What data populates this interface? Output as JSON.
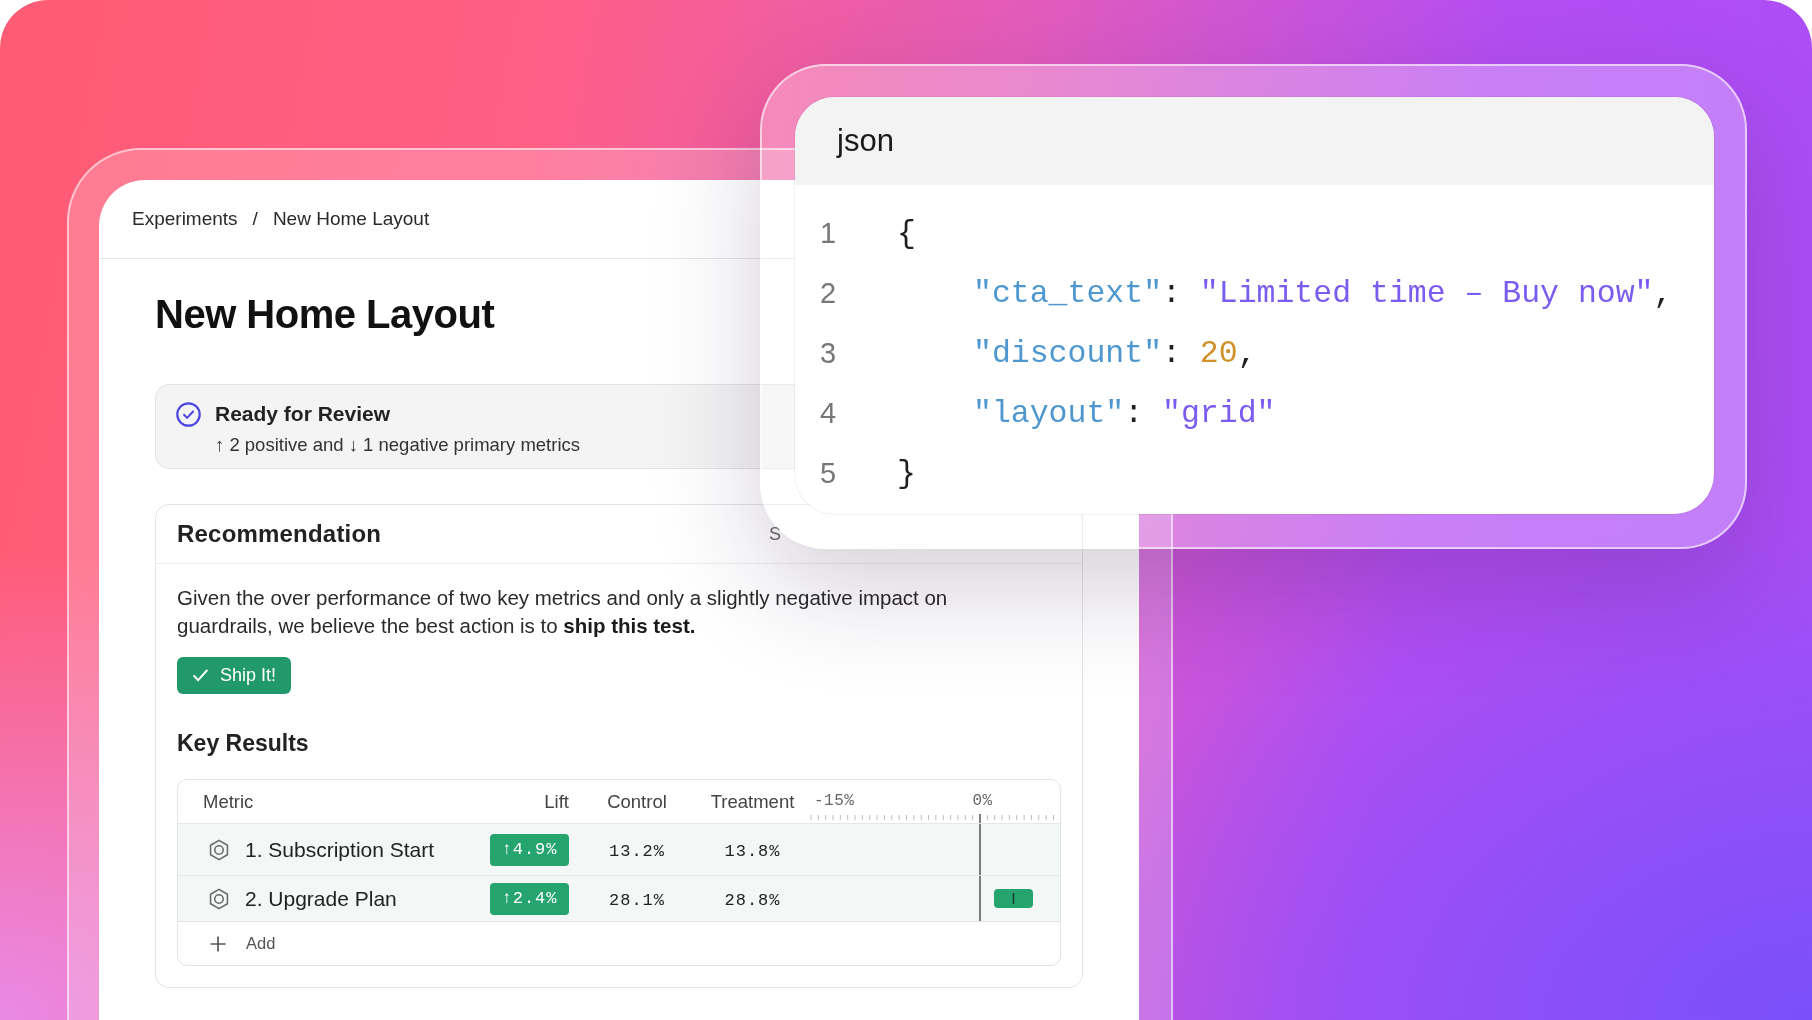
{
  "breadcrumb": {
    "items": [
      "Experiments",
      "New Home Layout"
    ],
    "separator": "/"
  },
  "title": "New Home Layout",
  "status": {
    "title": "Ready for Review",
    "summary": "↑ 2 positive and ↓ 1 negative primary metrics"
  },
  "recommendation": {
    "title": "Recommendation",
    "header_action": "S",
    "text": "Given the over performance of two key metrics and only a slightly negative impact on guardrails, we believe the best action is to **ship this test.**",
    "button": "Ship It!"
  },
  "key_results": {
    "title": "Key Results",
    "columns": [
      "Metric",
      "Lift",
      "Control",
      "Treatment"
    ],
    "axis_labels": [
      "-15%",
      "0%"
    ],
    "rows": [
      {
        "name": "1. Subscription Start",
        "lift": "↑4.9%",
        "control": "13.2%",
        "treatment": "13.8%",
        "interval_visible": false
      },
      {
        "name": "2. Upgrade Plan",
        "lift": "↑2.4%",
        "control": "28.1%",
        "treatment": "28.8%",
        "interval_visible": true
      }
    ],
    "add_label": "Add"
  },
  "code_window": {
    "title": "json",
    "lines": [
      {
        "number": "1",
        "tokens": [
          {
            "kind": "punct",
            "text": "{"
          }
        ],
        "children": [
          {
            "number": "2",
            "tokens": [
              {
                "kind": "key",
                "text": "\"cta_text\""
              },
              {
                "kind": "punct",
                "text": ": "
              },
              {
                "kind": "string",
                "text": "\"Limited time – Buy now\""
              },
              {
                "kind": "punct",
                "text": ","
              }
            ]
          },
          {
            "number": "3",
            "tokens": [
              {
                "kind": "key",
                "text": "\"discount\""
              },
              {
                "kind": "punct",
                "text": ": "
              },
              {
                "kind": "number",
                "text": "20"
              },
              {
                "kind": "punct",
                "text": ","
              }
            ]
          },
          {
            "number": "4",
            "tokens": [
              {
                "kind": "key",
                "text": "\"layout\""
              },
              {
                "kind": "punct",
                "text": ": "
              },
              {
                "kind": "string",
                "text": "\"grid\""
              }
            ]
          }
        ]
      },
      {
        "number": "5",
        "tokens": [
          {
            "kind": "punct",
            "text": "}"
          }
        ]
      }
    ]
  }
}
